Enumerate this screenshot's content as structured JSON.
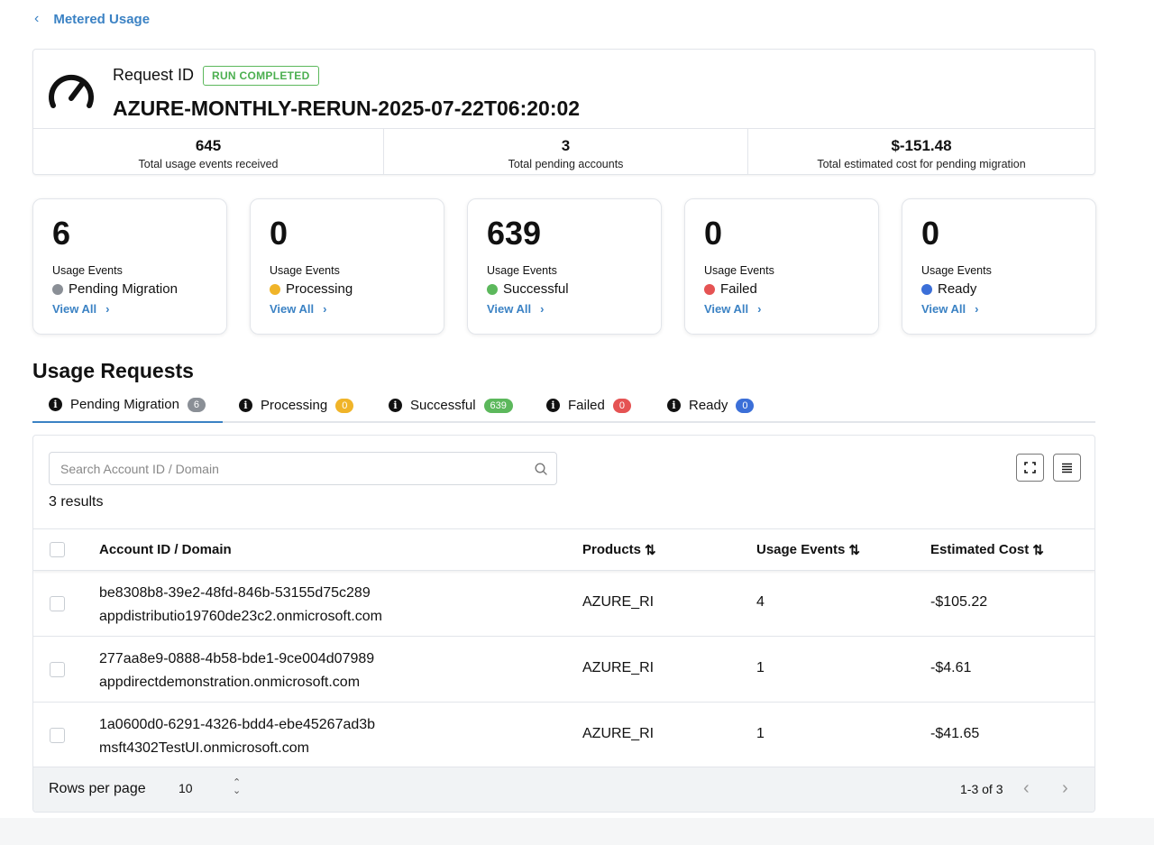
{
  "nav": {
    "back_label": "Metered Usage"
  },
  "summary": {
    "request_label": "Request ID",
    "status_badge": "RUN COMPLETED",
    "request_id": "AZURE-MONTHLY-RERUN-2025-07-22T06:20:02",
    "stats": [
      {
        "value": "645",
        "label": "Total usage events received"
      },
      {
        "value": "3",
        "label": "Total pending accounts"
      },
      {
        "value": "$-151.48",
        "label": "Total estimated cost for pending migration"
      }
    ]
  },
  "cards": [
    {
      "count": "6",
      "caption": "Usage Events",
      "status": "Pending Migration",
      "color": "#8a8f96",
      "link": "View All"
    },
    {
      "count": "0",
      "caption": "Usage Events",
      "status": "Processing",
      "color": "#f0b429",
      "link": "View All"
    },
    {
      "count": "639",
      "caption": "Usage Events",
      "status": "Successful",
      "color": "#5cb85c",
      "link": "View All"
    },
    {
      "count": "0",
      "caption": "Usage Events",
      "status": "Failed",
      "color": "#e55353",
      "link": "View All"
    },
    {
      "count": "0",
      "caption": "Usage Events",
      "status": "Ready",
      "color": "#3b6fd8",
      "link": "View All"
    }
  ],
  "section_title": "Usage Requests",
  "tabs": [
    {
      "label": "Pending Migration",
      "count": "6",
      "color": "#8a8f96"
    },
    {
      "label": "Processing",
      "count": "0",
      "color": "#f0b429"
    },
    {
      "label": "Successful",
      "count": "639",
      "color": "#5cb85c"
    },
    {
      "label": "Failed",
      "count": "0",
      "color": "#e55353"
    },
    {
      "label": "Ready",
      "count": "0",
      "color": "#3b6fd8"
    }
  ],
  "search": {
    "placeholder": "Search Account ID / Domain"
  },
  "results_text": "3 results",
  "table": {
    "headers": [
      "Account ID / Domain",
      "Products",
      "Usage Events",
      "Estimated Cost"
    ],
    "rows": [
      {
        "id": "be8308b8-39e2-48fd-846b-53155d75c289",
        "domain": "appdistributio19760de23c2.onmicrosoft.com",
        "product": "AZURE_RI",
        "events": "4",
        "cost": "-$105.22"
      },
      {
        "id": "277aa8e9-0888-4b58-bde1-9ce004d07989",
        "domain": "appdirectdemonstration.onmicrosoft.com",
        "product": "AZURE_RI",
        "events": "1",
        "cost": "-$4.61"
      },
      {
        "id": "1a0600d0-6291-4326-bdd4-ebe45267ad3b",
        "domain": "msft4302TestUI.onmicrosoft.com",
        "product": "AZURE_RI",
        "events": "1",
        "cost": "-$41.65"
      }
    ]
  },
  "pagination": {
    "rows_label": "Rows per page",
    "rows_value": "10",
    "range": "1-3 of 3"
  },
  "accent_color": "#3b82c4"
}
